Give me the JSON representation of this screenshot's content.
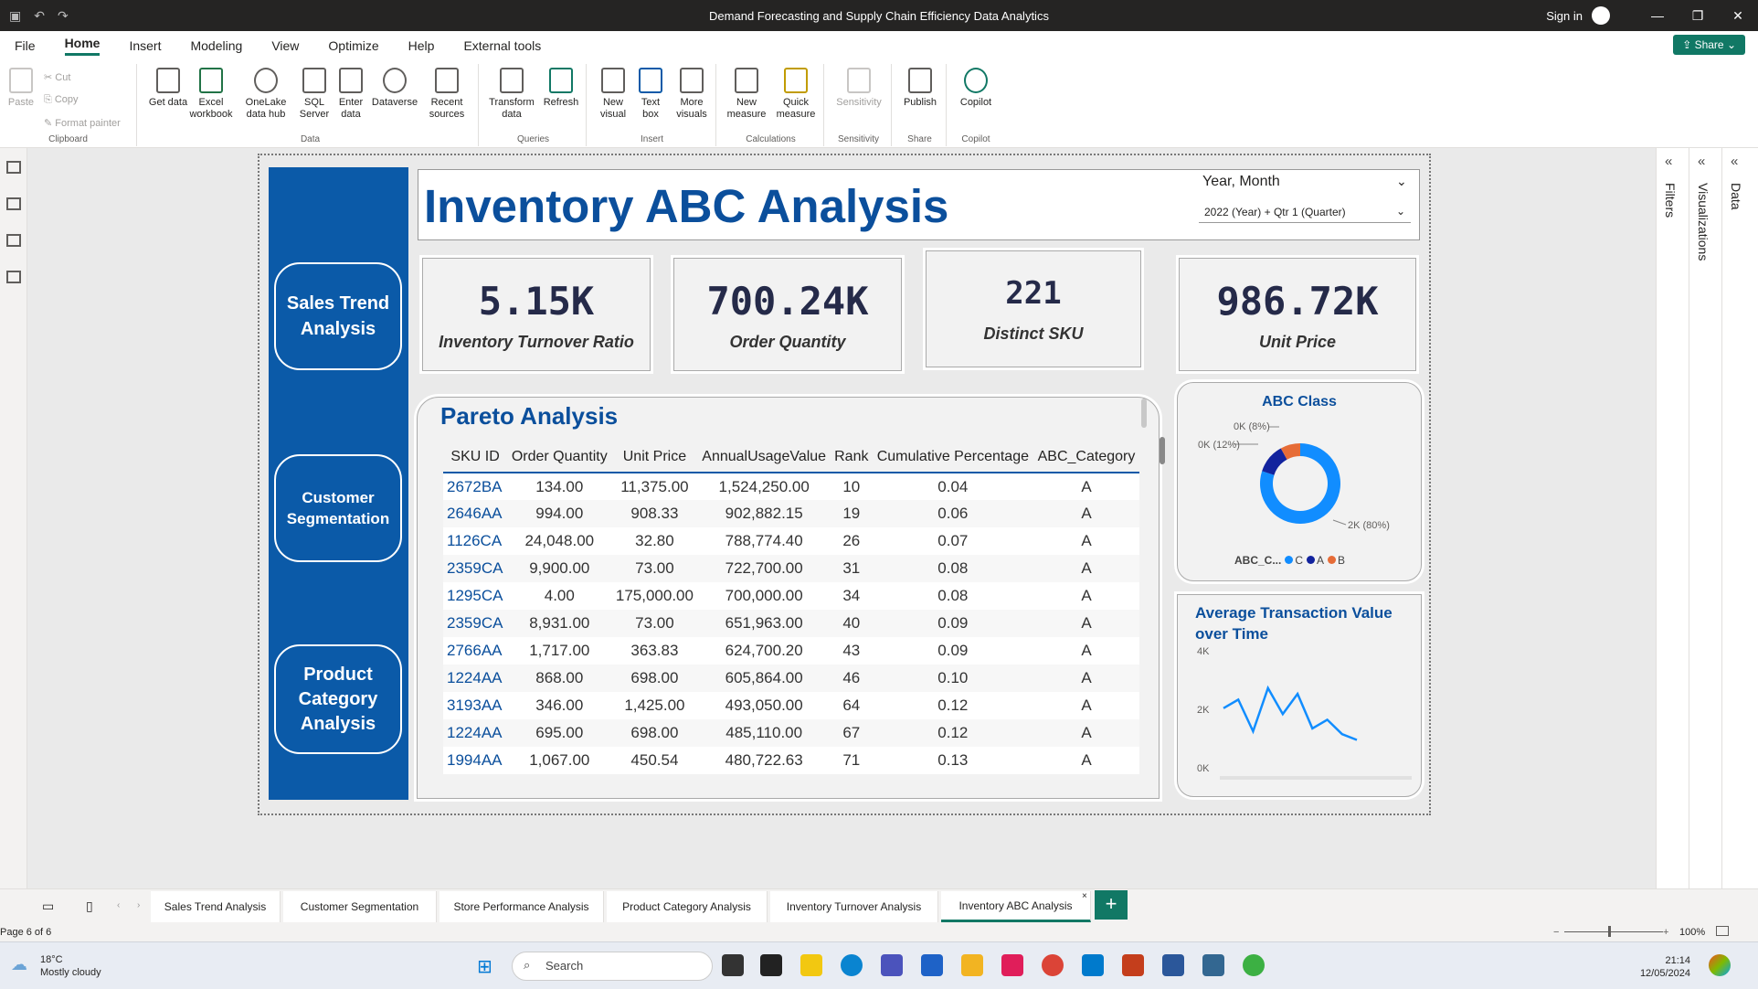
{
  "window": {
    "title": "Demand Forecasting and Supply Chain Efficiency Data Analytics",
    "sign_in": "Sign in",
    "share": "Share"
  },
  "menu": [
    "File",
    "Home",
    "Insert",
    "Modeling",
    "View",
    "Optimize",
    "Help",
    "External tools"
  ],
  "ribbon": {
    "clipboard": {
      "paste": "Paste",
      "cut": "Cut",
      "copy": "Copy",
      "format_painter": "Format painter",
      "label": "Clipboard"
    },
    "data": {
      "get_data": "Get data",
      "excel": "Excel workbook",
      "onelake": "OneLake data hub",
      "sql": "SQL Server",
      "enter": "Enter data",
      "dataverse": "Dataverse",
      "recent": "Recent sources",
      "label": "Data"
    },
    "queries": {
      "transform": "Transform data",
      "refresh": "Refresh",
      "label": "Queries"
    },
    "insert": {
      "new_visual": "New visual",
      "text_box": "Text box",
      "more_visuals": "More visuals",
      "label": "Insert"
    },
    "calculations": {
      "new_measure": "New measure",
      "quick_measure": "Quick measure",
      "label": "Calculations"
    },
    "sensitivity": {
      "sensitivity": "Sensitivity",
      "label": "Sensitivity"
    },
    "share": {
      "publish": "Publish",
      "label": "Share"
    },
    "copilot": {
      "copilot": "Copilot",
      "label": "Copilot"
    }
  },
  "nav": {
    "sales": "Sales Trend Analysis",
    "customer": "Customer Segmentation",
    "product": "Product Category Analysis"
  },
  "report": {
    "title": "Inventory ABC Analysis",
    "slicer_label": "Year, Month",
    "slicer_value": "2022 (Year) + Qtr 1 (Quarter)"
  },
  "kpis": [
    {
      "value": "5.15K",
      "label": "Inventory Turnover Ratio"
    },
    {
      "value": "700.24K",
      "label": "Order Quantity"
    },
    {
      "value": "221",
      "label": "Distinct SKU"
    },
    {
      "value": "986.72K",
      "label": "Unit Price"
    }
  ],
  "pareto": {
    "title": "Pareto Analysis",
    "columns": [
      "SKU ID",
      "Order Quantity",
      "Unit Price",
      "AnnualUsageValue",
      "Rank",
      "Cumulative Percentage",
      "ABC_Category"
    ],
    "rows": [
      [
        "2672BA",
        "134.00",
        "11,375.00",
        "1,524,250.00",
        "10",
        "0.04",
        "A"
      ],
      [
        "2646AA",
        "994.00",
        "908.33",
        "902,882.15",
        "19",
        "0.06",
        "A"
      ],
      [
        "1126CA",
        "24,048.00",
        "32.80",
        "788,774.40",
        "26",
        "0.07",
        "A"
      ],
      [
        "2359CA",
        "9,900.00",
        "73.00",
        "722,700.00",
        "31",
        "0.08",
        "A"
      ],
      [
        "1295CA",
        "4.00",
        "175,000.00",
        "700,000.00",
        "34",
        "0.08",
        "A"
      ],
      [
        "2359CA",
        "8,931.00",
        "73.00",
        "651,963.00",
        "40",
        "0.09",
        "A"
      ],
      [
        "2766AA",
        "1,717.00",
        "363.83",
        "624,700.20",
        "43",
        "0.09",
        "A"
      ],
      [
        "1224AA",
        "868.00",
        "698.00",
        "605,864.00",
        "46",
        "0.10",
        "A"
      ],
      [
        "3193AA",
        "346.00",
        "1,425.00",
        "493,050.00",
        "64",
        "0.12",
        "A"
      ],
      [
        "1224AA",
        "695.00",
        "698.00",
        "485,110.00",
        "67",
        "0.12",
        "A"
      ],
      [
        "1994AA",
        "1,067.00",
        "450.54",
        "480,722.63",
        "71",
        "0.13",
        "A"
      ]
    ]
  },
  "abc_chart": {
    "title": "ABC Class",
    "legend_title": "ABC_C...",
    "legend": [
      "C",
      "A",
      "B"
    ],
    "labels": [
      "0K (8%)",
      "0K (12%)",
      "2K (80%)"
    ]
  },
  "atv_chart": {
    "title": "Average Transaction Value over Time",
    "yticks": [
      "4K",
      "2K",
      "0K"
    ]
  },
  "chart_data": [
    {
      "type": "pie",
      "title": "ABC Class",
      "categories": [
        "C",
        "A",
        "B"
      ],
      "values": [
        80,
        12,
        8
      ],
      "colors": [
        "#118dff",
        "#12239e",
        "#e66c37"
      ]
    },
    {
      "type": "line",
      "title": "Average Transaction Value over Time",
      "x": [
        1,
        2,
        3,
        4,
        5,
        6,
        7,
        8,
        9,
        10
      ],
      "values": [
        2.1,
        2.4,
        1.3,
        2.8,
        1.9,
        2.6,
        1.4,
        1.7,
        1.2,
        1.0
      ],
      "ylim": [
        0,
        4
      ],
      "color": "#118dff"
    }
  ],
  "panes": [
    "Filters",
    "Visualizations",
    "Data"
  ],
  "tabs": [
    "Sales Trend Analysis",
    "Customer Segmentation",
    "Store Performance Analysis",
    "Product Category Analysis",
    "Inventory Turnover Analysis",
    "Inventory ABC Analysis"
  ],
  "status": {
    "page": "Page 6 of 6",
    "zoom": "100%"
  },
  "taskbar": {
    "temp": "18°C",
    "weather": "Mostly cloudy",
    "search": "Search",
    "time": "21:14",
    "date": "12/05/2024"
  }
}
